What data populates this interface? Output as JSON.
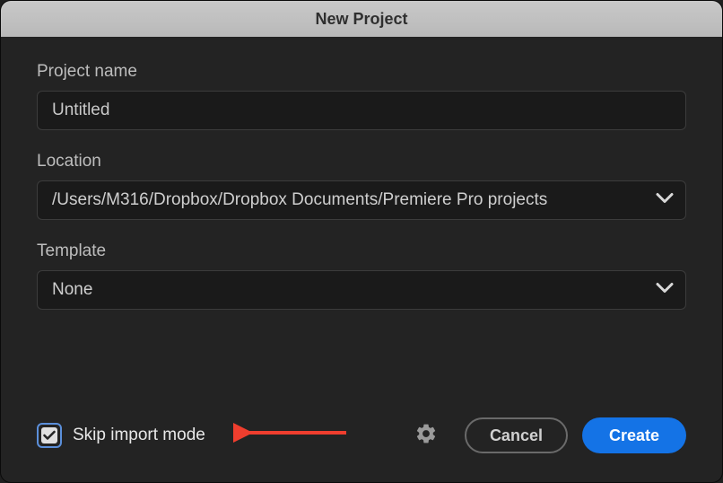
{
  "dialog": {
    "title": "New Project"
  },
  "fields": {
    "projectName": {
      "label": "Project name",
      "value": "Untitled"
    },
    "location": {
      "label": "Location",
      "value": "/Users/M316/Dropbox/Dropbox Documents/Premiere Pro projects"
    },
    "template": {
      "label": "Template",
      "value": "None"
    }
  },
  "footer": {
    "skipImport": {
      "label": "Skip import mode",
      "checked": true
    },
    "cancel": "Cancel",
    "create": "Create"
  }
}
